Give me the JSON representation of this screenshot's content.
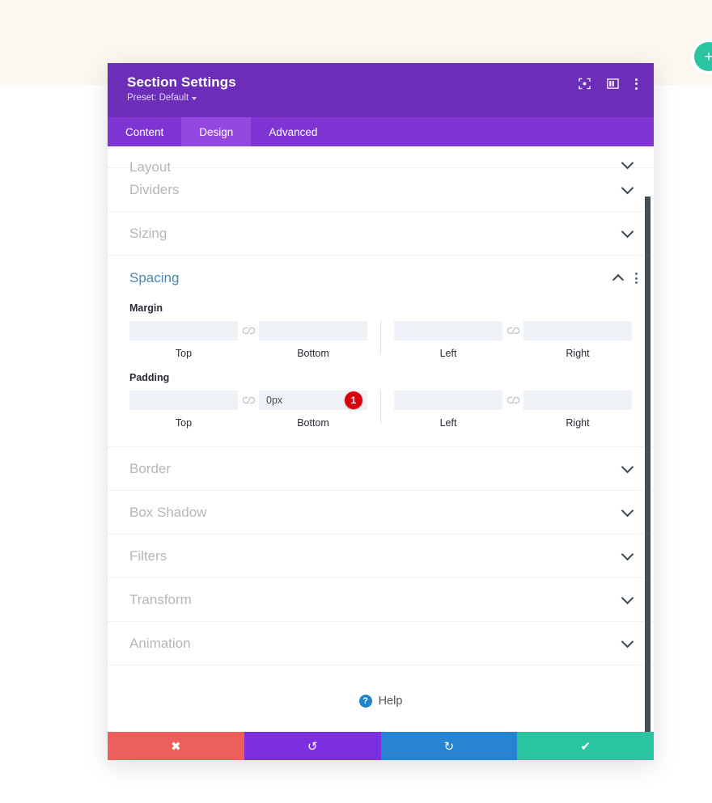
{
  "page": {
    "background_top_color": "#fdf8ef",
    "background_bottom_color": "#ffffff",
    "add_section_button_label": "+",
    "add_section_button_color": "#2ac4a1"
  },
  "modal": {
    "title": "Section Settings",
    "preset_label": "Preset: Default",
    "header_color": "#6c2eb9",
    "header_icons": [
      {
        "name": "focus-icon",
        "label": "Focus"
      },
      {
        "name": "layout-panel-icon",
        "label": "Layout"
      },
      {
        "name": "more-options-icon",
        "label": "More"
      }
    ],
    "tabs": [
      {
        "label": "Content",
        "active": false
      },
      {
        "label": "Design",
        "active": true
      },
      {
        "label": "Advanced",
        "active": false
      }
    ],
    "active_tab_color": "#9448e0",
    "tabbar_color": "#7f35d4"
  },
  "sections": [
    {
      "label": "Layout",
      "expanded": false,
      "clipped": true
    },
    {
      "label": "Dividers",
      "expanded": false,
      "clipped": false
    },
    {
      "label": "Sizing",
      "expanded": false,
      "clipped": false
    }
  ],
  "spacing": {
    "title": "Spacing",
    "title_color": "#4b87b8",
    "expanded": true,
    "margin": {
      "group_label": "Margin",
      "fields": [
        {
          "label": "Top",
          "value": "",
          "placeholder": ""
        },
        {
          "label": "Bottom",
          "value": "",
          "placeholder": ""
        },
        {
          "label": "Left",
          "value": "",
          "placeholder": ""
        },
        {
          "label": "Right",
          "value": "",
          "placeholder": ""
        }
      ],
      "link_icon": "unlink-icon"
    },
    "padding": {
      "group_label": "Padding",
      "fields": [
        {
          "label": "Top",
          "value": "",
          "placeholder": ""
        },
        {
          "label": "Bottom",
          "value": "0px",
          "placeholder": "",
          "badge": "1"
        },
        {
          "label": "Left",
          "value": "",
          "placeholder": ""
        },
        {
          "label": "Right",
          "value": "",
          "placeholder": ""
        }
      ],
      "link_icon": "unlink-icon",
      "badge_value": "1",
      "badge_color": "#d8000f"
    }
  },
  "sections_after": [
    {
      "label": "Border",
      "expanded": false
    },
    {
      "label": "Box Shadow",
      "expanded": false
    },
    {
      "label": "Filters",
      "expanded": false
    },
    {
      "label": "Transform",
      "expanded": false
    },
    {
      "label": "Animation",
      "expanded": false
    }
  ],
  "help": {
    "label": "Help",
    "icon_glyph": "?",
    "icon_color": "#2283c7"
  },
  "actions": [
    {
      "name": "cancel-button",
      "glyph": "✖",
      "color": "#ec5f5b"
    },
    {
      "name": "undo-button",
      "glyph": "↺",
      "color": "#7d2ee0"
    },
    {
      "name": "redo-button",
      "glyph": "↻",
      "color": "#2684d3"
    },
    {
      "name": "save-button",
      "glyph": "✔",
      "color": "#2ac4a1"
    }
  ],
  "scrollbar": {
    "color": "#43505a"
  }
}
